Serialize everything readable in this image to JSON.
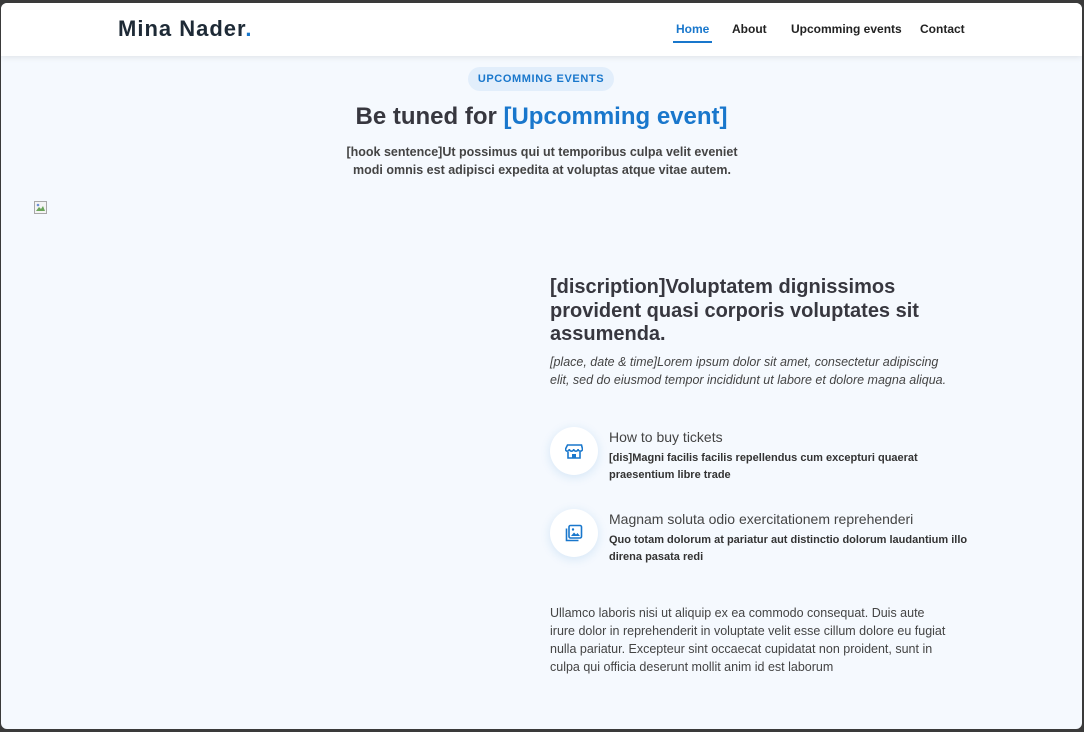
{
  "header": {
    "logo_text": "Mina Nader",
    "logo_dot": ".",
    "nav": [
      "Home",
      "About",
      "Upcomming events",
      "Contact"
    ]
  },
  "section": {
    "badge": "Upcomming Events",
    "title_plain": "Be tuned for ",
    "title_highlight": "[Upcomming event]",
    "hook": "[hook sentence]Ut possimus qui ut temporibus culpa velit eveniet modi omnis est adipisci expedita at voluptas atque vitae autem."
  },
  "event": {
    "description": "[discription]Voluptatem dignissimos provident quasi corporis voluptates sit assumenda.",
    "place": "[place, date & time]Lorem ipsum dolor sit amet, consectetur adipiscing elit, sed do eiusmod tempor incididunt ut labore et dolore magna aliqua.",
    "features": [
      {
        "icon": "store-icon",
        "title": "How to buy tickets",
        "text": "[dis]Magni facilis facilis repellendus cum excepturi quaerat praesentium libre trade"
      },
      {
        "icon": "images-icon",
        "title": "Magnam soluta odio exercitationem reprehenderi",
        "text": "Quo totam dolorum at pariatur aut distinctio dolorum laudantium illo direna pasata redi"
      }
    ],
    "closing": "Ullamco laboris nisi ut aliquip ex ea commodo consequat. Duis aute irure dolor in reprehenderit in voluptate velit esse cillum dolore eu fugiat nulla pariatur. Excepteur sint occaecat cupidatat non proident, sunt in culpa qui officia deserunt mollit anim id est laborum"
  },
  "colors": {
    "accent": "#1977cc",
    "background": "#f5f9fe",
    "heading": "#37373f"
  }
}
